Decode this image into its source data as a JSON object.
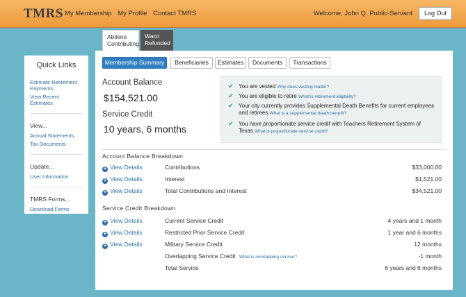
{
  "header": {
    "logo": "TMRS",
    "nav": [
      "My Membership",
      "My Profile",
      "Contact TMRS"
    ],
    "welcome": "Welcome, John Q. Public-Servant",
    "logout": "Log Out"
  },
  "sidebar": {
    "title": "Quick Links",
    "links1": [
      "Estimate Retirement Payments",
      "View Recent Estimates"
    ],
    "view_title": "View...",
    "view_links": [
      "Annual Statements",
      "Tax Documents"
    ],
    "update_title": "Update...",
    "update_links": [
      "User Information"
    ],
    "forms_title": "TMRS Forms...",
    "forms_links": [
      "Download Forms"
    ]
  },
  "plans": [
    {
      "line1": "Abilene",
      "line2": "Contributing"
    },
    {
      "line1": "Waco",
      "line2": "Refunded"
    }
  ],
  "tabs": [
    "Membership Summary",
    "Beneficiaries",
    "Estimates",
    "Documents",
    "Transactions"
  ],
  "summary": {
    "balance_label": "Account Balance",
    "balance_value": "$154,521.00",
    "service_label": "Service Credit",
    "service_value": "10 years, 6 months"
  },
  "info": [
    {
      "text": "You are vested",
      "link": "Why does vesting matter?"
    },
    {
      "text": "You are eligible to retire",
      "link": "What is retirement eligibility?"
    },
    {
      "text": "Your city currently provides Supplemental Death Benefits for current employees and retirees",
      "link": "What is a supplemental death benefit?"
    },
    {
      "text": "You have proportionate service credit with Teachers Retirement System of Texas",
      "link": "What is proportionate service credit?"
    }
  ],
  "view_details": "View Details",
  "balance_breakdown": {
    "title": "Account Balance Breakdown",
    "rows": [
      {
        "label": "Contributions",
        "value": "$33,000.00"
      },
      {
        "label": "Interest",
        "value": "$1,521.00"
      },
      {
        "label": "Total Contributions and Interest",
        "value": "$34,521.00"
      }
    ]
  },
  "service_breakdown": {
    "title": "Service Credit Breakdown",
    "rows": [
      {
        "label": "Current Service Credit",
        "value": "4 years and 1 month"
      },
      {
        "label": "Restricted Prior Service Credit",
        "value": "1 year and 6 months"
      },
      {
        "label": "Military Service Credit",
        "value": "12 months"
      },
      {
        "label": "Overlapping Service Credit",
        "link": "What is overlapping service?",
        "value": "-1 month"
      },
      {
        "label": "Total Service",
        "value": "6 years and 6 months"
      }
    ]
  }
}
